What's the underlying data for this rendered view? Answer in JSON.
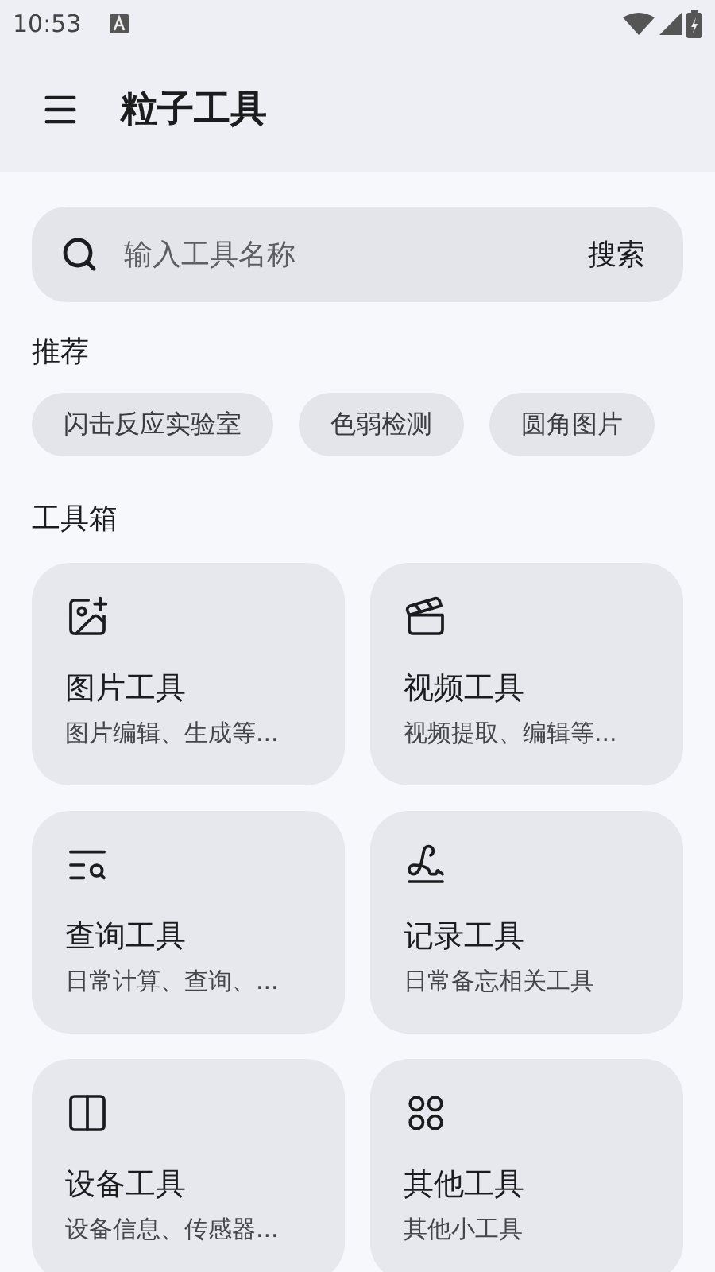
{
  "status_bar": {
    "time": "10:53"
  },
  "app_bar": {
    "title": "粒子工具"
  },
  "search": {
    "placeholder": "输入工具名称",
    "button": "搜索"
  },
  "recommended": {
    "heading": "推荐",
    "chips": [
      "闪击反应实验室",
      "色弱检测",
      "圆角图片"
    ]
  },
  "toolbox": {
    "heading": "工具箱",
    "cards": [
      {
        "kind": "image",
        "title": "图片工具",
        "subtitle": "图片编辑、生成等..."
      },
      {
        "kind": "video",
        "title": "视频工具",
        "subtitle": "视频提取、编辑等..."
      },
      {
        "kind": "query",
        "title": "查询工具",
        "subtitle": "日常计算、查询、..."
      },
      {
        "kind": "record",
        "title": "记录工具",
        "subtitle": "日常备忘相关工具"
      },
      {
        "kind": "device",
        "title": "设备工具",
        "subtitle": "设备信息、传感器..."
      },
      {
        "kind": "other",
        "title": "其他工具",
        "subtitle": "其他小工具"
      }
    ]
  }
}
